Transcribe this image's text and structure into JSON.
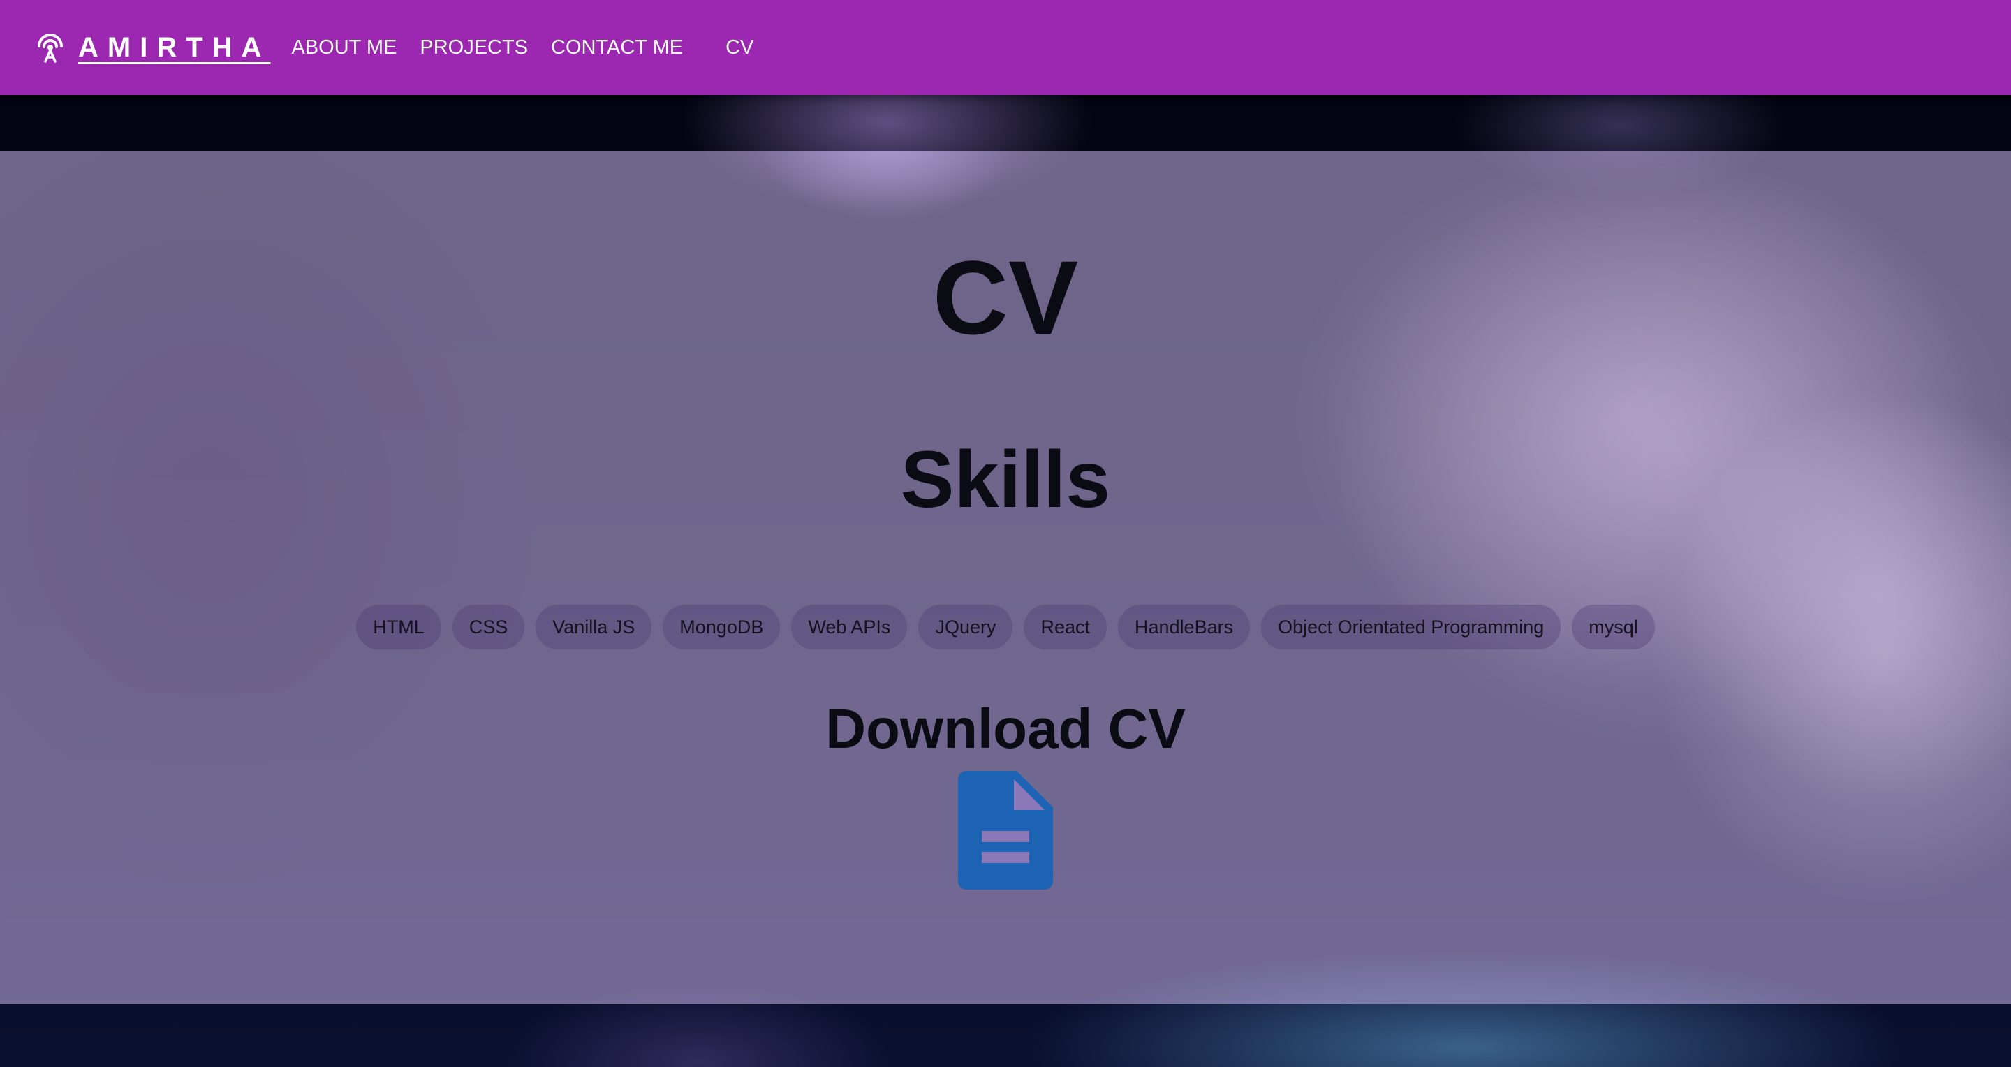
{
  "navbar": {
    "brand": "AMIRTHA",
    "brand_icon": "radio-tower-icon",
    "links": [
      "ABOUT ME",
      "PROJECTS",
      "CONTACT ME",
      "CV"
    ]
  },
  "main": {
    "title": "CV",
    "skills_heading": "Skills",
    "skills": [
      "HTML",
      "CSS",
      "Vanilla JS",
      "MongoDB",
      "Web APIs",
      "JQuery",
      "React",
      "HandleBars",
      "Object Orientated Programming",
      "mysql"
    ],
    "download_heading": "Download CV",
    "download_icon": "document-icon"
  },
  "colors": {
    "navbar_bg": "#9c27b0",
    "doc_icon": "#1d63b3",
    "heading_text": "#0b0b14"
  }
}
